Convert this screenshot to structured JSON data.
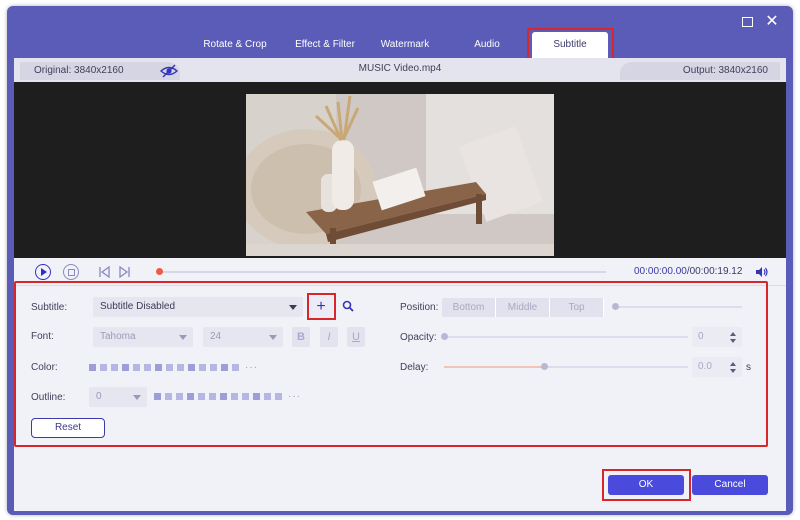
{
  "tabs": [
    {
      "label": "Rotate & Crop"
    },
    {
      "label": "Effect & Filter"
    },
    {
      "label": "Watermark"
    },
    {
      "label": "Audio"
    },
    {
      "label": "Subtitle",
      "active": true
    }
  ],
  "info": {
    "original": "Original: 3840x2160",
    "file_name": "MUSIC Video.mp4",
    "output": "Output: 3840x2160"
  },
  "player": {
    "current_time": "00:00:00.00",
    "total_time": "/00:00:19.12",
    "progress": 0.0
  },
  "subtitle": {
    "subtitle_label": "Subtitle:",
    "subtitle_value": "Subtitle Disabled",
    "add_label": "+",
    "font_label": "Font:",
    "font_value": "Tahoma",
    "size_value": "24",
    "bold": "B",
    "italic": "I",
    "underline": "U",
    "color_label": "Color:",
    "outline_label": "Outline:",
    "outline_value": "0",
    "more": "···",
    "reset_label": "Reset"
  },
  "position": {
    "label": "Position:",
    "options": [
      "Bottom",
      "Middle",
      "Top"
    ]
  },
  "opacity": {
    "label": "Opacity:",
    "value": "0",
    "slider_fraction": 0.0
  },
  "delay": {
    "label": "Delay:",
    "value": "0.0",
    "unit": "s",
    "slider_fraction": 0.41
  },
  "footer": {
    "ok_label": "OK",
    "cancel_label": "Cancel"
  },
  "colors": {
    "accent": "#4a4bdc",
    "window_frame": "#5a5cb8",
    "highlight": "#d9262a"
  }
}
